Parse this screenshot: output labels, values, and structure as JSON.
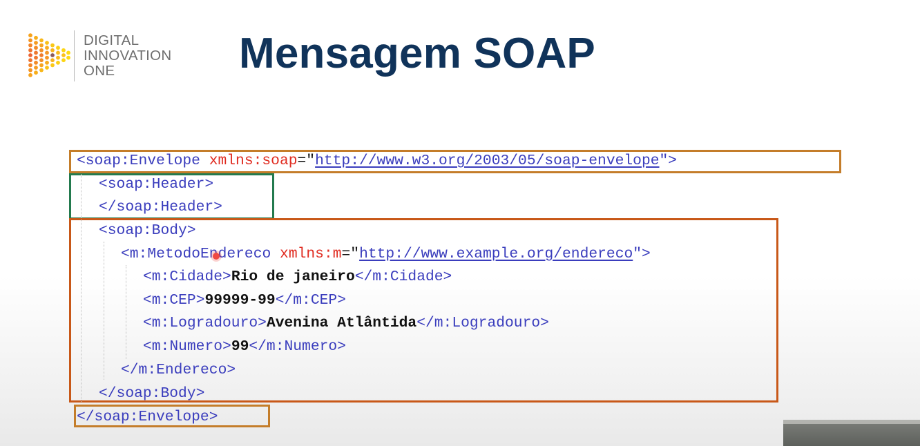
{
  "logo": {
    "line1": "DIGITAL",
    "line2": "INNOVATION",
    "line3": "ONE"
  },
  "slide_title": "Mensagem SOAP",
  "code": {
    "l1": {
      "open": "<soap:Envelope ",
      "attr": "xmlns:soap",
      "eq": "=\"",
      "url": "http://www.w3.org/2003/05/soap-envelope",
      "close": "\">"
    },
    "l2": "<soap:Header>",
    "l3": "</soap:Header>",
    "l4": "<soap:Body>",
    "l5": {
      "open": "<m:MetodoEndereco ",
      "attr": "xmlns:m",
      "eq": "=\"",
      "url": "http://www.example.org/endereco",
      "close": "\">"
    },
    "l6": {
      "open": "<m:Cidade>",
      "text": "Rio de janeiro",
      "close": "</m:Cidade>"
    },
    "l7": {
      "open": "<m:CEP>",
      "text": "99999-99",
      "close": "</m:CEP>"
    },
    "l8": {
      "open": "<m:Logradouro>",
      "text": "Avenina Atlântida",
      "close": "</m:Logradouro>"
    },
    "l9": {
      "open": "<m:Numero>",
      "text": "99",
      "close": "</m:Numero>"
    },
    "l10": "</m:Endereco>",
    "l11": "</soap:Body>",
    "l12": "</soap:Envelope>"
  },
  "colors": {
    "title": "#10335a",
    "tag": "#3a3dbd",
    "attribute": "#e02b20",
    "box_envelope": "#c47d2a",
    "box_header": "#237a4e",
    "box_body": "#c85818"
  }
}
